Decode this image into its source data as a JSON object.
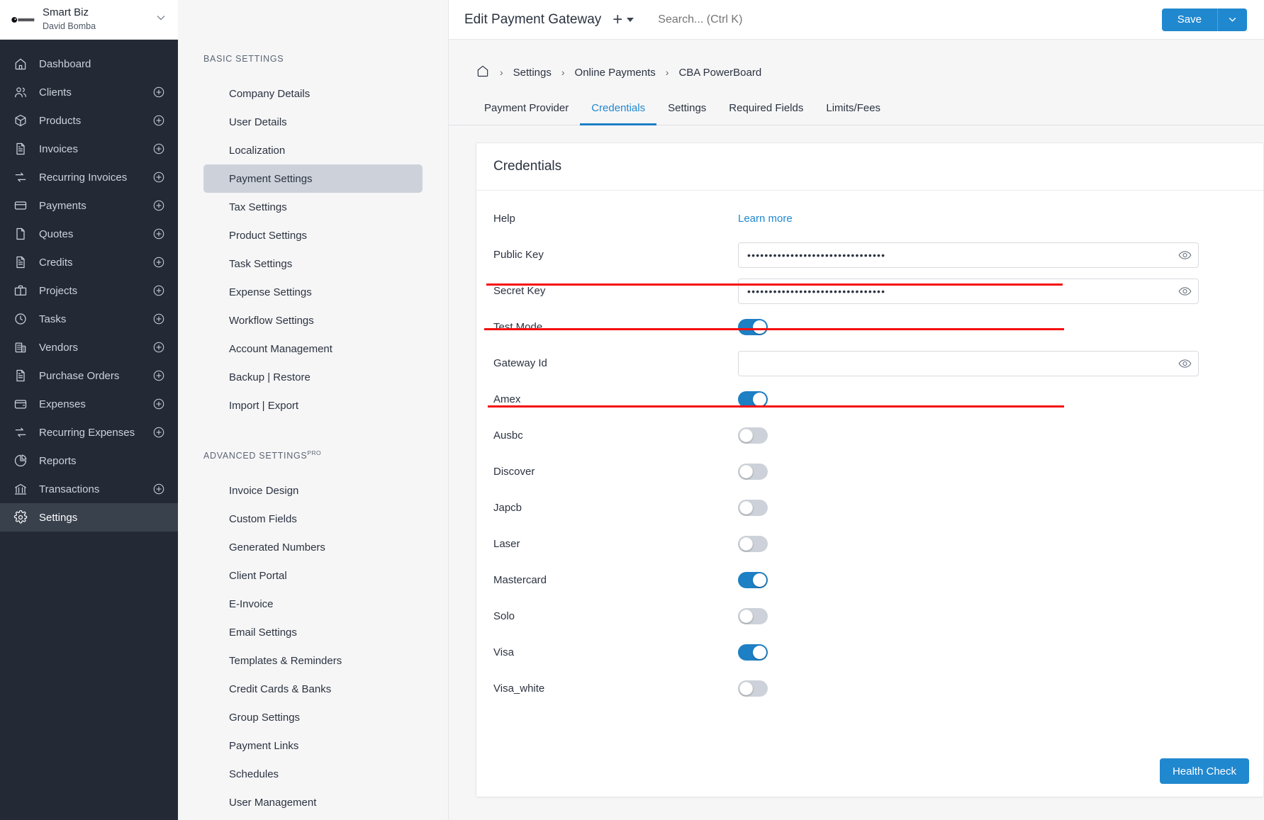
{
  "company": {
    "name": "Smart Biz",
    "user": "David Bomba",
    "logo_icon": "invoiceninja-logo-icon",
    "chevron_icon": "chevron-down-icon"
  },
  "nav": {
    "items": [
      {
        "label": "Dashboard",
        "icon": "home-icon",
        "add": false,
        "active": false
      },
      {
        "label": "Clients",
        "icon": "users-icon",
        "add": true,
        "active": false
      },
      {
        "label": "Products",
        "icon": "box-icon",
        "add": true,
        "active": false
      },
      {
        "label": "Invoices",
        "icon": "document-icon",
        "add": true,
        "active": false
      },
      {
        "label": "Recurring Invoices",
        "icon": "repeat-icon",
        "add": true,
        "active": false
      },
      {
        "label": "Payments",
        "icon": "credit-card-icon",
        "add": true,
        "active": false
      },
      {
        "label": "Quotes",
        "icon": "file-icon",
        "add": true,
        "active": false
      },
      {
        "label": "Credits",
        "icon": "document-icon",
        "add": true,
        "active": false
      },
      {
        "label": "Projects",
        "icon": "briefcase-icon",
        "add": true,
        "active": false
      },
      {
        "label": "Tasks",
        "icon": "clock-icon",
        "add": true,
        "active": false
      },
      {
        "label": "Vendors",
        "icon": "building-icon",
        "add": true,
        "active": false
      },
      {
        "label": "Purchase Orders",
        "icon": "document-icon",
        "add": true,
        "active": false
      },
      {
        "label": "Expenses",
        "icon": "wallet-icon",
        "add": true,
        "active": false
      },
      {
        "label": "Recurring Expenses",
        "icon": "repeat-icon",
        "add": true,
        "active": false
      },
      {
        "label": "Reports",
        "icon": "pie-chart-icon",
        "add": false,
        "active": false
      },
      {
        "label": "Transactions",
        "icon": "bank-icon",
        "add": true,
        "active": false
      },
      {
        "label": "Settings",
        "icon": "gear-icon",
        "add": false,
        "active": true
      }
    ]
  },
  "settings_panel": {
    "basic": {
      "title": "BASIC SETTINGS",
      "items": [
        {
          "label": "Company Details",
          "active": false
        },
        {
          "label": "User Details",
          "active": false
        },
        {
          "label": "Localization",
          "active": false
        },
        {
          "label": "Payment Settings",
          "active": true
        },
        {
          "label": "Tax Settings",
          "active": false
        },
        {
          "label": "Product Settings",
          "active": false
        },
        {
          "label": "Task Settings",
          "active": false
        },
        {
          "label": "Expense Settings",
          "active": false
        },
        {
          "label": "Workflow Settings",
          "active": false
        },
        {
          "label": "Account Management",
          "active": false
        },
        {
          "label": "Backup | Restore",
          "active": false
        },
        {
          "label": "Import | Export",
          "active": false
        }
      ]
    },
    "advanced": {
      "title": "ADVANCED SETTINGS",
      "badge": "PRO",
      "items": [
        {
          "label": "Invoice Design",
          "active": false
        },
        {
          "label": "Custom Fields",
          "active": false
        },
        {
          "label": "Generated Numbers",
          "active": false
        },
        {
          "label": "Client Portal",
          "active": false
        },
        {
          "label": "E-Invoice",
          "active": false
        },
        {
          "label": "Email Settings",
          "active": false
        },
        {
          "label": "Templates & Reminders",
          "active": false
        },
        {
          "label": "Credit Cards & Banks",
          "active": false
        },
        {
          "label": "Group Settings",
          "active": false
        },
        {
          "label": "Payment Links",
          "active": false
        },
        {
          "label": "Schedules",
          "active": false
        },
        {
          "label": "User Management",
          "active": false
        }
      ]
    }
  },
  "topbar": {
    "title": "Edit Payment Gateway",
    "plus_icon": "plus-icon",
    "caret_icon": "caret-down-icon",
    "search_placeholder": "Search... (Ctrl K)",
    "search_value": "",
    "save_label": "Save",
    "save_caret_icon": "chevron-down-icon",
    "accent_color": "#2088cf"
  },
  "breadcrumb": {
    "home_icon": "home-icon",
    "separator": "›",
    "items": [
      "Settings",
      "Online Payments",
      "CBA PowerBoard"
    ]
  },
  "tabs": [
    {
      "label": "Payment Provider",
      "active": false
    },
    {
      "label": "Credentials",
      "active": true
    },
    {
      "label": "Settings",
      "active": false
    },
    {
      "label": "Required Fields",
      "active": false
    },
    {
      "label": "Limits/Fees",
      "active": false
    }
  ],
  "credentials": {
    "heading": "Credentials",
    "help": {
      "label": "Help",
      "link_label": "Learn more"
    },
    "fields": [
      {
        "label": "Public Key",
        "type": "password",
        "value": "••••••••••••••••••••••••••••••••",
        "placeholder": "",
        "eye_icon": "eye-icon"
      },
      {
        "label": "Secret Key",
        "type": "password",
        "value": "••••••••••••••••••••••••••••••••",
        "placeholder": "",
        "eye_icon": "eye-icon"
      }
    ],
    "test_mode": {
      "label": "Test Mode",
      "on": true
    },
    "gateway_id": {
      "label": "Gateway Id",
      "value": "",
      "placeholder": "",
      "eye_icon": "eye-icon"
    },
    "card_toggles": [
      {
        "label": "Amex",
        "on": true
      },
      {
        "label": "Ausbc",
        "on": false
      },
      {
        "label": "Discover",
        "on": false
      },
      {
        "label": "Japcb",
        "on": false
      },
      {
        "label": "Laser",
        "on": false
      },
      {
        "label": "Mastercard",
        "on": true
      },
      {
        "label": "Solo",
        "on": false
      },
      {
        "label": "Visa",
        "on": true
      },
      {
        "label": "Visa_white",
        "on": false
      }
    ],
    "health_check_label": "Health Check",
    "annotation_color": "#f60e0e"
  }
}
